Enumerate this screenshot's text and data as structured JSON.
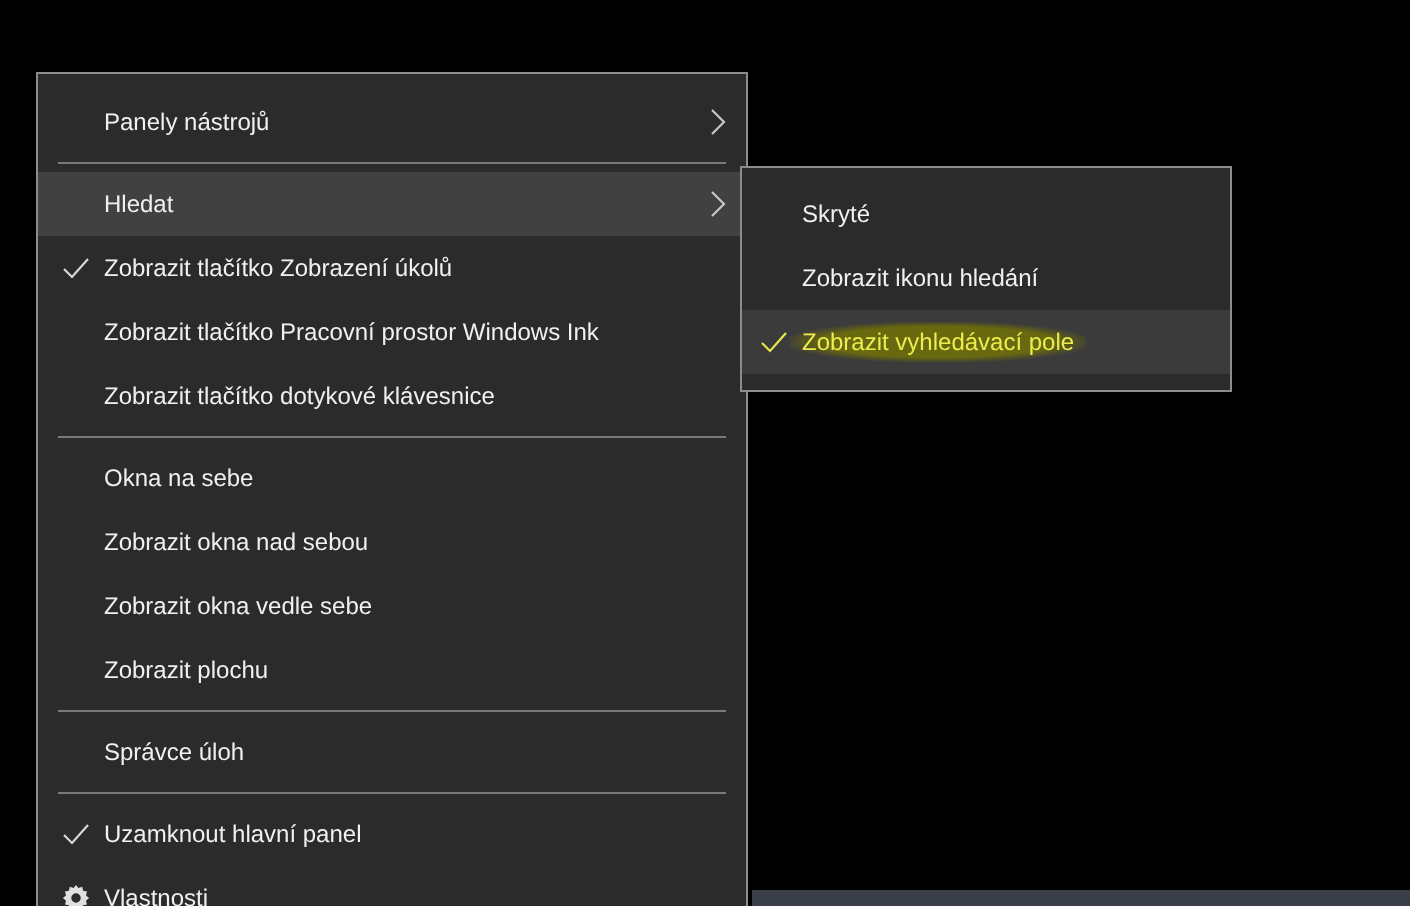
{
  "menu": {
    "items": [
      {
        "kind": "item",
        "label": "Panely nástrojů",
        "checked": false,
        "submenu": true,
        "selected": false
      },
      {
        "kind": "separator"
      },
      {
        "kind": "item",
        "label": "Hledat",
        "checked": false,
        "submenu": true,
        "selected": true
      },
      {
        "kind": "item",
        "label": "Zobrazit tlačítko Zobrazení úkolů",
        "checked": true,
        "submenu": false,
        "selected": false
      },
      {
        "kind": "item",
        "label": "Zobrazit tlačítko Pracovní prostor Windows Ink",
        "checked": false,
        "submenu": false,
        "selected": false
      },
      {
        "kind": "item",
        "label": "Zobrazit tlačítko dotykové klávesnice",
        "checked": false,
        "submenu": false,
        "selected": false
      },
      {
        "kind": "separator"
      },
      {
        "kind": "item",
        "label": "Okna na sebe",
        "checked": false,
        "submenu": false,
        "selected": false
      },
      {
        "kind": "item",
        "label": "Zobrazit okna nad sebou",
        "checked": false,
        "submenu": false,
        "selected": false
      },
      {
        "kind": "item",
        "label": "Zobrazit okna vedle sebe",
        "checked": false,
        "submenu": false,
        "selected": false
      },
      {
        "kind": "item",
        "label": "Zobrazit plochu",
        "checked": false,
        "submenu": false,
        "selected": false
      },
      {
        "kind": "separator"
      },
      {
        "kind": "item",
        "label": "Správce úloh",
        "checked": false,
        "submenu": false,
        "selected": false
      },
      {
        "kind": "separator"
      },
      {
        "kind": "item",
        "label": "Uzamknout hlavní panel",
        "checked": true,
        "submenu": false,
        "selected": false
      },
      {
        "kind": "settings",
        "label": "Vlastnosti",
        "checked": false,
        "submenu": false,
        "selected": false
      }
    ]
  },
  "submenu": {
    "items": [
      {
        "label": "Skryté",
        "checked": false,
        "selected": false,
        "highlighted": false
      },
      {
        "label": "Zobrazit ikonu hledání",
        "checked": false,
        "selected": false,
        "highlighted": false
      },
      {
        "label": "Zobrazit vyhledávací pole",
        "checked": true,
        "selected": true,
        "highlighted": true
      }
    ]
  }
}
